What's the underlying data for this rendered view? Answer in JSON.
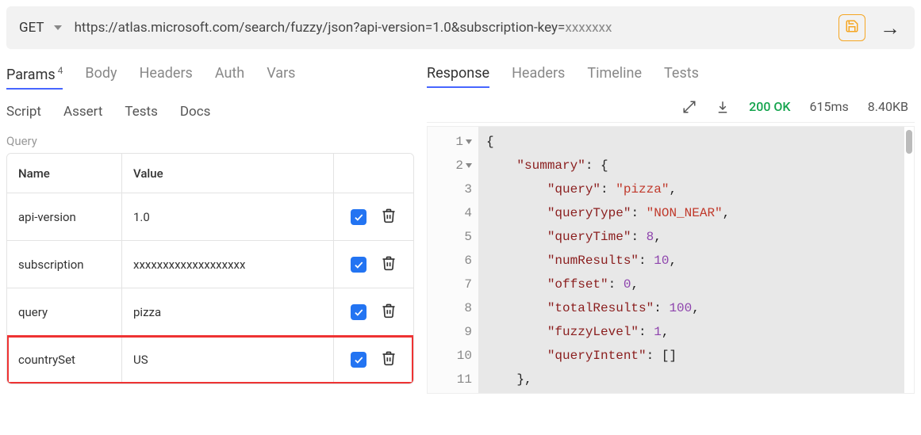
{
  "request": {
    "method": "GET",
    "url_prefix": "https://atlas.microsoft.com/search/fuzzy/json?api-version=1.0&subscription-key=",
    "url_masked": "xxxxxxx"
  },
  "tabs_left": {
    "params": "Params",
    "params_count": "4",
    "body": "Body",
    "headers": "Headers",
    "auth": "Auth",
    "vars": "Vars"
  },
  "subtabs_left": {
    "script": "Script",
    "assert": "Assert",
    "tests": "Tests",
    "docs": "Docs"
  },
  "query": {
    "label": "Query",
    "header_name": "Name",
    "header_value": "Value",
    "rows": [
      {
        "name": "api-version",
        "value": "1.0",
        "highlight": false
      },
      {
        "name": "subscription",
        "value": "xxxxxxxxxxxxxxxxxxx",
        "highlight": false
      },
      {
        "name": "query",
        "value": "pizza",
        "highlight": false
      },
      {
        "name": "countrySet",
        "value": "US",
        "highlight": true
      }
    ]
  },
  "tabs_right": {
    "response": "Response",
    "headers": "Headers",
    "timeline": "Timeline",
    "tests": "Tests"
  },
  "response_meta": {
    "status": "200 OK",
    "time": "615ms",
    "size": "8.40KB"
  },
  "code_lines": [
    {
      "n": "1",
      "foldable": true,
      "tokens": [
        [
          "brace",
          "{"
        ]
      ]
    },
    {
      "n": "2",
      "foldable": true,
      "tokens": [
        [
          "ind",
          "    "
        ],
        [
          "key",
          "\"summary\""
        ],
        [
          "pun",
          ": "
        ],
        [
          "brace",
          "{"
        ]
      ]
    },
    {
      "n": "3",
      "foldable": false,
      "tokens": [
        [
          "ind",
          "        "
        ],
        [
          "key",
          "\"query\""
        ],
        [
          "pun",
          ": "
        ],
        [
          "str",
          "\"pizza\""
        ],
        [
          "pun",
          ","
        ]
      ]
    },
    {
      "n": "4",
      "foldable": false,
      "tokens": [
        [
          "ind",
          "        "
        ],
        [
          "key",
          "\"queryType\""
        ],
        [
          "pun",
          ": "
        ],
        [
          "str",
          "\"NON_NEAR\""
        ],
        [
          "pun",
          ","
        ]
      ]
    },
    {
      "n": "5",
      "foldable": false,
      "tokens": [
        [
          "ind",
          "        "
        ],
        [
          "key",
          "\"queryTime\""
        ],
        [
          "pun",
          ": "
        ],
        [
          "num",
          "8"
        ],
        [
          "pun",
          ","
        ]
      ]
    },
    {
      "n": "6",
      "foldable": false,
      "tokens": [
        [
          "ind",
          "        "
        ],
        [
          "key",
          "\"numResults\""
        ],
        [
          "pun",
          ": "
        ],
        [
          "num",
          "10"
        ],
        [
          "pun",
          ","
        ]
      ]
    },
    {
      "n": "7",
      "foldable": false,
      "tokens": [
        [
          "ind",
          "        "
        ],
        [
          "key",
          "\"offset\""
        ],
        [
          "pun",
          ": "
        ],
        [
          "num",
          "0"
        ],
        [
          "pun",
          ","
        ]
      ]
    },
    {
      "n": "8",
      "foldable": false,
      "tokens": [
        [
          "ind",
          "        "
        ],
        [
          "key",
          "\"totalResults\""
        ],
        [
          "pun",
          ": "
        ],
        [
          "num",
          "100"
        ],
        [
          "pun",
          ","
        ]
      ]
    },
    {
      "n": "9",
      "foldable": false,
      "tokens": [
        [
          "ind",
          "        "
        ],
        [
          "key",
          "\"fuzzyLevel\""
        ],
        [
          "pun",
          ": "
        ],
        [
          "num",
          "1"
        ],
        [
          "pun",
          ","
        ]
      ]
    },
    {
      "n": "10",
      "foldable": false,
      "tokens": [
        [
          "ind",
          "        "
        ],
        [
          "key",
          "\"queryIntent\""
        ],
        [
          "pun",
          ": []"
        ]
      ]
    },
    {
      "n": "11",
      "foldable": false,
      "tokens": [
        [
          "ind",
          "    "
        ],
        [
          "brace",
          "}"
        ],
        [
          "pun",
          ","
        ]
      ]
    }
  ],
  "chart_data": {
    "summary": {
      "query": "pizza",
      "queryType": "NON_NEAR",
      "queryTime": 8,
      "numResults": 10,
      "offset": 0,
      "totalResults": 100,
      "fuzzyLevel": 1,
      "queryIntent": []
    }
  }
}
